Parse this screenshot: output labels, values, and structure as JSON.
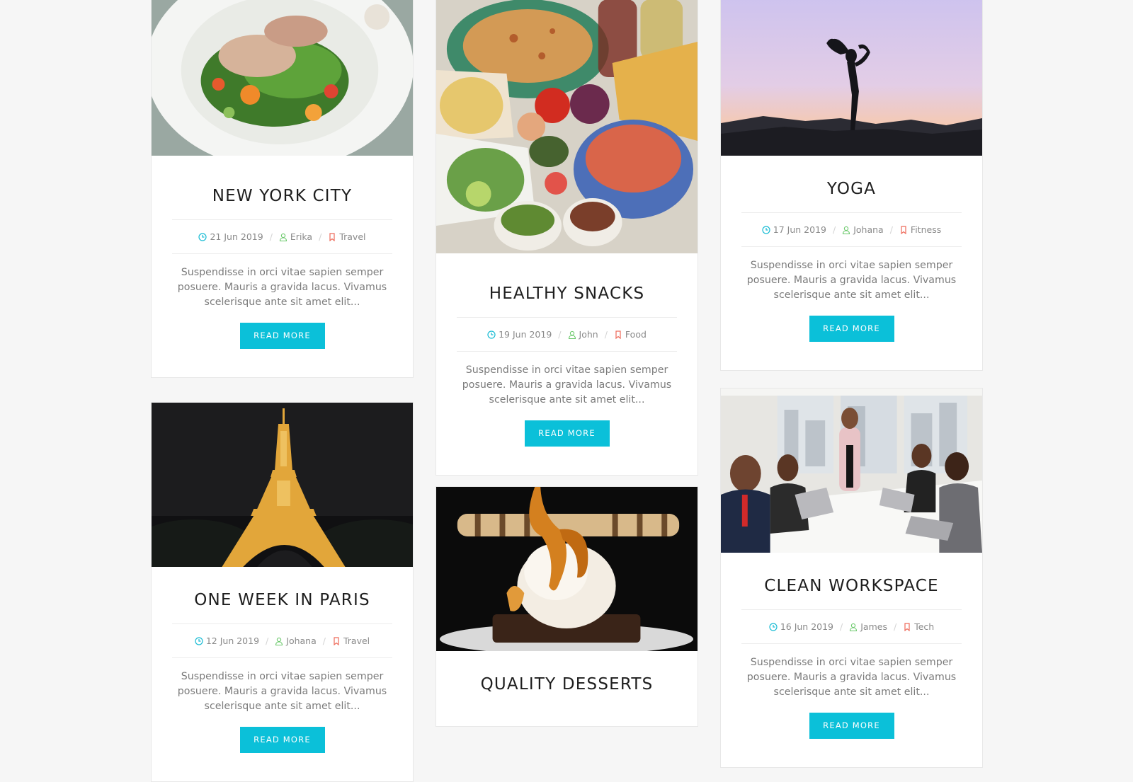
{
  "colors": {
    "accent": "#0bc0d9",
    "clock": "#19bcd4",
    "user": "#6cc96c",
    "tag": "#ee6a5a"
  },
  "posts": [
    {
      "title": "NEW YORK CITY",
      "date": "21 Jun 2019",
      "author": "Erika",
      "category": "Travel",
      "excerpt": "Suspendisse in orci vitae sapien semper posuere. Mauris a gravida lacus. Vivamus scelerisque ante sit amet elit...",
      "button": "READ MORE"
    },
    {
      "title": "HEALTHY SNACKS",
      "date": "19 Jun 2019",
      "author": "John",
      "category": "Food",
      "excerpt": "Suspendisse in orci vitae sapien semper posuere. Mauris a gravida lacus. Vivamus scelerisque ante sit amet elit...",
      "button": "READ MORE"
    },
    {
      "title": "YOGA",
      "date": "17 Jun 2019",
      "author": "Johana",
      "category": "Fitness",
      "excerpt": "Suspendisse in orci vitae sapien semper posuere. Mauris a gravida lacus. Vivamus scelerisque ante sit amet elit...",
      "button": "READ MORE"
    },
    {
      "title": "ONE WEEK IN PARIS",
      "date": "12 Jun 2019",
      "author": "Johana",
      "category": "Travel",
      "excerpt": "Suspendisse in orci vitae sapien semper posuere. Mauris a gravida lacus. Vivamus scelerisque ante sit amet elit...",
      "button": "READ MORE"
    },
    {
      "title": "QUALITY DESSERTS"
    },
    {
      "title": "CLEAN WORKSPACE",
      "date": "16 Jun 2019",
      "author": "James",
      "category": "Tech",
      "excerpt": "Suspendisse in orci vitae sapien semper posuere. Mauris a gravida lacus. Vivamus scelerisque ante sit amet elit...",
      "button": "READ MORE"
    }
  ]
}
